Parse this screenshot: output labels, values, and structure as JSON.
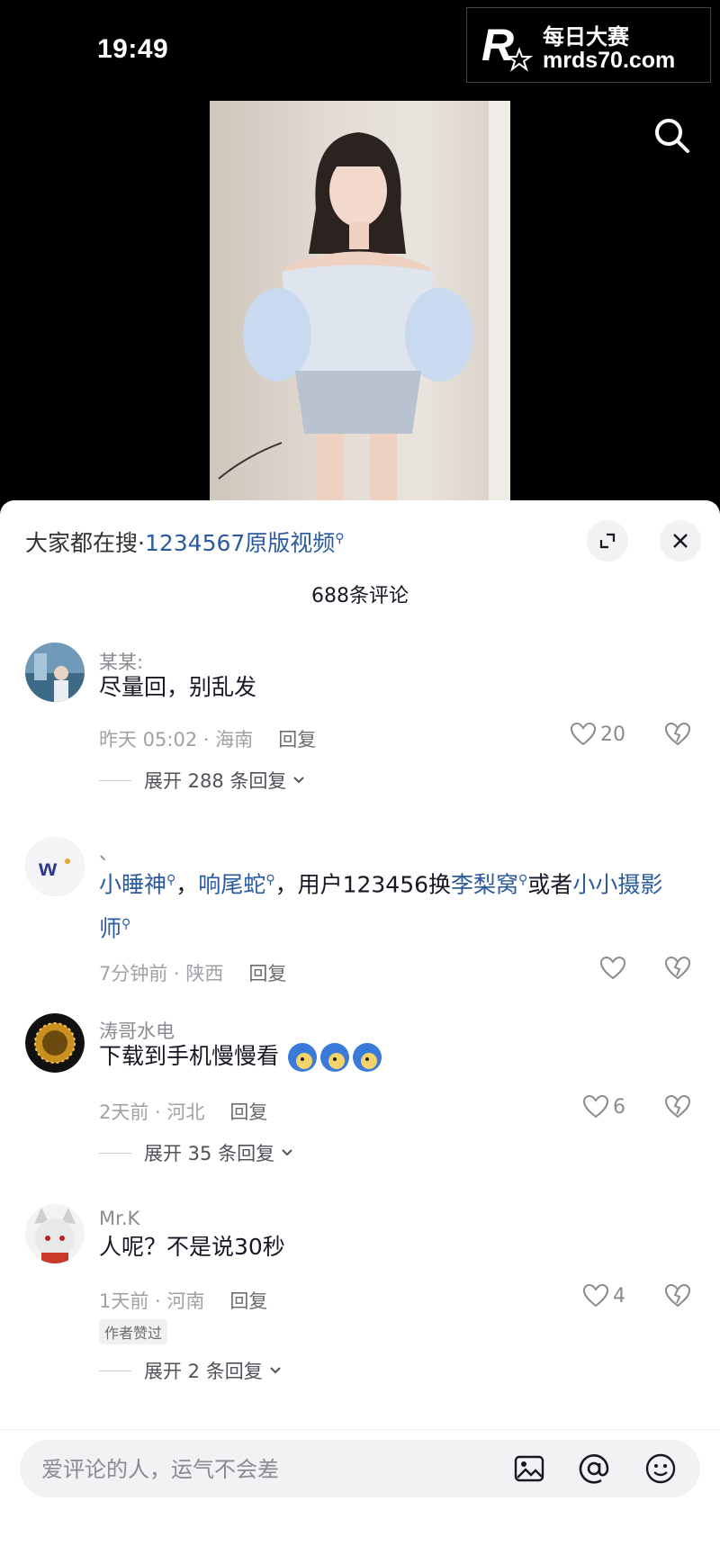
{
  "status_bar": {
    "time": "19:49"
  },
  "watermark": {
    "line1": "每日大赛",
    "line2": "mrds70.com"
  },
  "video": {
    "description": "video thumbnail"
  },
  "comments_panel": {
    "hot_search_prefix": "大家都在搜·",
    "hot_search_keyword": "1234567原版视频",
    "comment_count": "688条评论",
    "comments": [
      {
        "username": "某某:",
        "text": "尽量回，别乱发",
        "time": "昨天 05:02 · 海南",
        "reply_label": "回复",
        "likes": "20",
        "expand": "展开 288 条回复"
      },
      {
        "username": "、",
        "text_parts": [
          "小睡神",
          "，",
          "响尾蛇",
          "，用户123456换",
          "李梨窝",
          "或者",
          "小小摄影师"
        ],
        "time": "7分钟前 · 陕西",
        "reply_label": "回复",
        "likes": ""
      },
      {
        "username": "涛哥水电",
        "text": "下载到手机慢慢看",
        "time": "2天前 · 河北",
        "reply_label": "回复",
        "likes": "6",
        "expand": "展开 35 条回复"
      },
      {
        "username": "Mr.K",
        "text": "人呢？不是说30秒",
        "time": "1天前 · 河南",
        "reply_label": "回复",
        "likes": "4",
        "badge": "作者赞过",
        "expand": "展开 2 条回复"
      }
    ],
    "input_placeholder": "爱评论的人，运气不会差"
  },
  "colors": {
    "link_blue": "#2a5b9f",
    "muted": "#8a8b91",
    "background": "#000000"
  },
  "icons": [
    "search-icon",
    "collapse-icon",
    "close-icon",
    "heart-icon",
    "dislike-heart-icon",
    "image-icon",
    "at-icon",
    "emoji-icon",
    "chevron-down-icon"
  ]
}
